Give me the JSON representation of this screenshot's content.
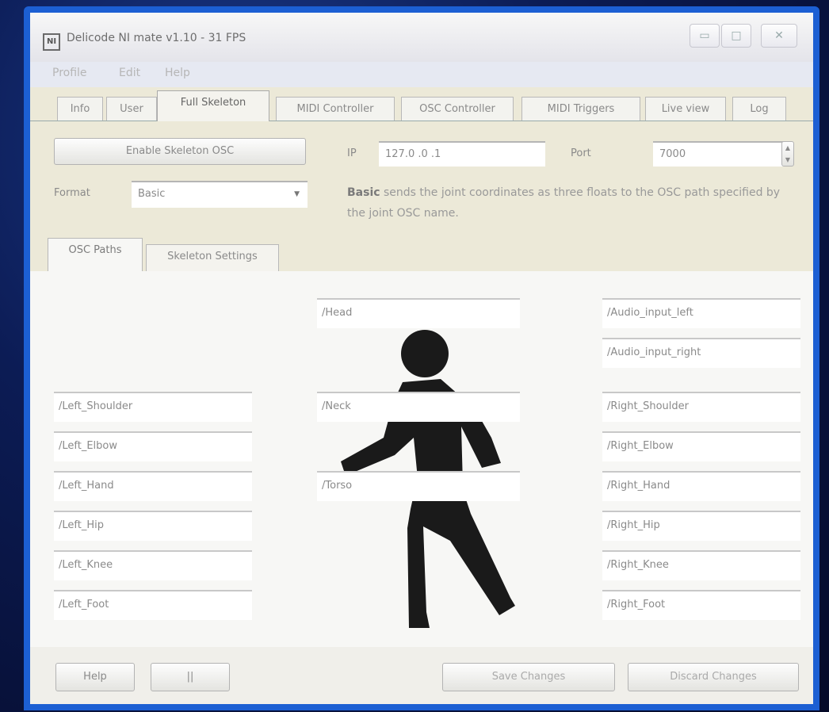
{
  "window": {
    "title": "Delicode NI mate v1.10 - 31 FPS",
    "icon": "NI"
  },
  "titlebar_buttons": [
    "minimize-icon",
    "maximize-icon",
    "close-icon"
  ],
  "titlebar_glyphs": {
    "minimize": "▭",
    "maximize": "□",
    "close": "✕"
  },
  "menu": [
    "Profile",
    "Edit",
    "Help"
  ],
  "tabs": [
    "Info",
    "User",
    "Full Skeleton",
    "MIDI Controller",
    "OSC Controller",
    "MIDI Triggers",
    "Live view",
    "Log"
  ],
  "active_tab": "Full Skeleton",
  "controls": {
    "enable_button": "Enable Skeleton OSC",
    "ip_label": "IP",
    "ip_value": "127.0 .0 .1",
    "port_label": "Port",
    "port_value": "7000",
    "format_label": "Format",
    "format_value": "Basic",
    "description_bold": "Basic",
    "description": "sends the joint coordinates as three floats to the OSC path specified by the joint OSC name."
  },
  "subtabs": [
    "OSC Paths",
    "Skeleton Settings"
  ],
  "joints": {
    "center": [
      "/Head",
      "/Neck",
      "/Torso"
    ],
    "left": [
      "/Left_Shoulder",
      "/Left_Elbow",
      "/Left_Hand",
      "/Left_Hip",
      "/Left_Knee",
      "/Left_Foot"
    ],
    "right_audio": [
      "/Audio_input_left",
      "/Audio_input_right"
    ],
    "right": [
      "/Right_Shoulder",
      "/Right_Elbow",
      "/Right_Hand",
      "/Right_Hip",
      "/Right_Knee",
      "/Right_Foot"
    ]
  },
  "footer": {
    "help": "Help",
    "pause": "||",
    "save": "Save Changes",
    "discard": "Discard Changes"
  },
  "colors": {
    "window_frame": "#1c5fd3",
    "figure": "#1a1a1a"
  }
}
